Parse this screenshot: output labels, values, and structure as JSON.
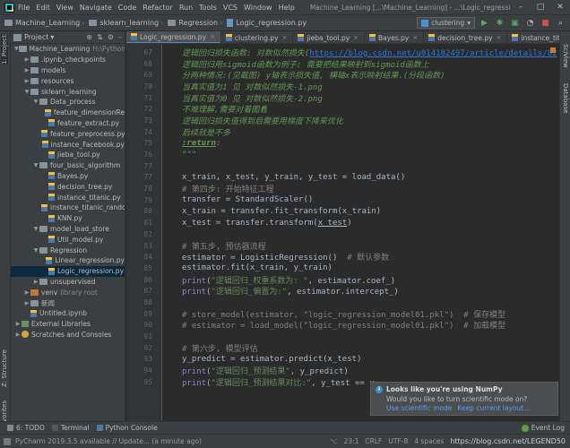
{
  "menubar": {
    "items": [
      "File",
      "Edit",
      "View",
      "Navigate",
      "Code",
      "Refactor",
      "Run",
      "Tools",
      "VCS",
      "Window",
      "Help"
    ],
    "window_title": "Machine_Learning [...\\Machine_Learning] - ...\\Logic_regression.py",
    "controls": [
      "–",
      "□",
      "✕"
    ]
  },
  "navbar": {
    "breadcrumbs": [
      "Machine_Learning",
      "sklearn_learning",
      "Regression",
      "Logic_regression.py"
    ],
    "run_config": "clustering"
  },
  "project": {
    "title": "Project",
    "tree": [
      {
        "indent": 0,
        "type": "folder",
        "label": "Machine_Learning",
        "extra": "H:\\Python_l",
        "open": true
      },
      {
        "indent": 1,
        "type": "folder",
        "label": ".ipynb_checkpoints",
        "open": false
      },
      {
        "indent": 1,
        "type": "folder",
        "label": "models",
        "open": false
      },
      {
        "indent": 1,
        "type": "folder",
        "label": "resources",
        "open": false
      },
      {
        "indent": 1,
        "type": "folder",
        "label": "sklearn_learning",
        "open": true
      },
      {
        "indent": 2,
        "type": "folder",
        "label": "Data_process",
        "open": true
      },
      {
        "indent": 3,
        "type": "py",
        "label": "feature_dimensionRe"
      },
      {
        "indent": 3,
        "type": "py",
        "label": "feature_extract.py"
      },
      {
        "indent": 3,
        "type": "py",
        "label": "feature_preprocess.py"
      },
      {
        "indent": 3,
        "type": "py",
        "label": "instance_Facebook.py"
      },
      {
        "indent": 3,
        "type": "py",
        "label": "jieba_tool.py"
      },
      {
        "indent": 2,
        "type": "folder",
        "label": "four_basic_algorithm",
        "open": true
      },
      {
        "indent": 3,
        "type": "py",
        "label": "Bayes.py"
      },
      {
        "indent": 3,
        "type": "py",
        "label": "decision_tree.py"
      },
      {
        "indent": 3,
        "type": "py",
        "label": "instance_titanic.py"
      },
      {
        "indent": 3,
        "type": "py",
        "label": "instance_titanic_rando"
      },
      {
        "indent": 3,
        "type": "py",
        "label": "KNN.py"
      },
      {
        "indent": 2,
        "type": "folder",
        "label": "model_load_store",
        "open": true
      },
      {
        "indent": 3,
        "type": "py",
        "label": "Util_model.py"
      },
      {
        "indent": 2,
        "type": "folder",
        "label": "Regression",
        "open": true
      },
      {
        "indent": 3,
        "type": "py",
        "label": "Linear_regression.py"
      },
      {
        "indent": 3,
        "type": "py",
        "label": "Logic_regression.py",
        "selected": true
      },
      {
        "indent": 2,
        "type": "folder",
        "label": "unsupervised",
        "open": false
      },
      {
        "indent": 1,
        "type": "excluded",
        "label": "venv",
        "extra": "library root",
        "open": false
      },
      {
        "indent": 1,
        "type": "folder",
        "label": "新闻",
        "open": false
      },
      {
        "indent": 1,
        "type": "py",
        "label": "Untitled.ipynb"
      },
      {
        "indent": 0,
        "type": "lib",
        "label": "External Libraries",
        "open": false
      },
      {
        "indent": 0,
        "type": "scratch",
        "label": "Scratches and Consoles",
        "open": false
      }
    ]
  },
  "tabs": [
    {
      "label": "Logic_regression.py",
      "active": true
    },
    {
      "label": "clustering.py"
    },
    {
      "label": "jieba_tool.py"
    },
    {
      "label": "Bayes.py"
    },
    {
      "label": "decision_tree.py"
    },
    {
      "label": "instance_titanic.py"
    }
  ],
  "code_lines": [
    {
      "n": "67",
      "indent": "",
      "parts": [
        {
          "t": "逻辑回归损失函数: 对数似然损失(",
          "c": "doc"
        },
        {
          "t": "https://blog.csdn.net/u014182497/article/details/82",
          "c": "link"
        }
      ]
    },
    {
      "n": "68",
      "indent": "",
      "parts": [
        {
          "t": "逻辑回归用sigmoid函数为例子: 需要把结果映射到sigmoid函数上",
          "c": "doc"
        }
      ]
    },
    {
      "n": "69",
      "indent": "",
      "parts": [
        {
          "t": "分两种情况:(见截图) y轴表示损失值, 横轴x表示映射结果.(分段函数)",
          "c": "doc"
        }
      ]
    },
    {
      "n": "70",
      "indent": "",
      "parts": [
        {
          "t": "当真实值为1 见 对数似然损失-1.png",
          "c": "doc"
        }
      ]
    },
    {
      "n": "71",
      "indent": "",
      "parts": [
        {
          "t": "当真实值为0 见 对数似然损失-2.png",
          "c": "doc"
        }
      ]
    },
    {
      "n": "72",
      "indent": "",
      "parts": [
        {
          "t": "不难理解,需要对着图看",
          "c": "doc"
        }
      ]
    },
    {
      "n": "73",
      "indent": "",
      "parts": [
        {
          "t": "逻辑回归损失值得到后需要用梯度下降来优化",
          "c": "doc"
        }
      ]
    },
    {
      "n": "74",
      "indent": "",
      "parts": [
        {
          "t": "后续就是不多",
          "c": "doc"
        }
      ]
    },
    {
      "n": "75",
      "indent": "",
      "parts": [
        {
          "t": ":return",
          "c": "tag"
        },
        {
          "t": ":",
          "c": "doc"
        }
      ]
    },
    {
      "n": "76",
      "indent": "",
      "parts": [
        {
          "t": "\"\"\"",
          "c": "doc"
        }
      ]
    },
    {
      "n": "77",
      "indent": "",
      "parts": []
    },
    {
      "n": "77",
      "indent": "",
      "parts": [
        {
          "t": "x_train, x_test, y_train, y_test = load_data()",
          "c": "plain"
        }
      ]
    },
    {
      "n": "78",
      "indent": "",
      "parts": [
        {
          "t": "# 第四步: 开始特征工程",
          "c": "com"
        }
      ]
    },
    {
      "n": "79",
      "indent": "",
      "parts": [
        {
          "t": "transfer = StandardScaler()",
          "c": "plain"
        }
      ]
    },
    {
      "n": "80",
      "indent": "",
      "parts": [
        {
          "t": "x_train = transfer.fit_transform(x_train)",
          "c": "plain"
        }
      ]
    },
    {
      "n": "81",
      "indent": "",
      "parts": [
        {
          "t": "x_test = transfer.transform(",
          "c": "plain"
        },
        {
          "t": "x_test",
          "c": "ul"
        },
        {
          "t": ")",
          "c": "plain"
        }
      ]
    },
    {
      "n": "82",
      "indent": "",
      "parts": []
    },
    {
      "n": "83",
      "indent": "",
      "parts": [
        {
          "t": "# 第五步, 预估器流程",
          "c": "com"
        }
      ]
    },
    {
      "n": "84",
      "indent": "",
      "parts": [
        {
          "t": "estimator = LogisticRegression()  ",
          "c": "plain"
        },
        {
          "t": "# 默认参数",
          "c": "com"
        }
      ]
    },
    {
      "n": "85",
      "indent": "",
      "parts": [
        {
          "t": "estimator.fit(x_train, y_train)",
          "c": "plain"
        }
      ]
    },
    {
      "n": "86",
      "indent": "",
      "parts": [
        {
          "t": "print",
          "c": "kw"
        },
        {
          "t": "(",
          "c": "plain"
        },
        {
          "t": "\"逻辑回归_权重系数为: \"",
          "c": "str"
        },
        {
          "t": ", estimator.coef_)",
          "c": "plain"
        }
      ]
    },
    {
      "n": "87",
      "indent": "",
      "parts": [
        {
          "t": "print",
          "c": "kw"
        },
        {
          "t": "(",
          "c": "plain"
        },
        {
          "t": "\"逻辑回归_偏置为:\"",
          "c": "str"
        },
        {
          "t": ", estimator.intercept_)",
          "c": "plain"
        }
      ]
    },
    {
      "n": "88",
      "indent": "",
      "parts": []
    },
    {
      "n": "89",
      "indent": "",
      "parts": [
        {
          "t": "# store_model(estimator, \"logic_regression_model01.pkl\")  # 保存模型",
          "c": "com"
        }
      ]
    },
    {
      "n": "90",
      "indent": "",
      "parts": [
        {
          "t": "# estimator = load_model(\"logic_regression_model01.pkl\")  # 加载模型",
          "c": "com"
        }
      ]
    },
    {
      "n": "91",
      "indent": "",
      "parts": []
    },
    {
      "n": "92",
      "indent": "",
      "parts": [
        {
          "t": "# 第六步, 模型评估",
          "c": "com"
        }
      ]
    },
    {
      "n": "93",
      "indent": "",
      "parts": [
        {
          "t": "y_predict = estimator.predict(x_test)",
          "c": "plain"
        }
      ]
    },
    {
      "n": "94",
      "indent": "",
      "parts": [
        {
          "t": "print",
          "c": "kw"
        },
        {
          "t": "(",
          "c": "plain"
        },
        {
          "t": "\"逻辑回归_预测结果\"",
          "c": "str"
        },
        {
          "t": ", y_predict)",
          "c": "plain"
        }
      ]
    },
    {
      "n": "95",
      "indent": "",
      "parts": [
        {
          "t": "print",
          "c": "kw"
        },
        {
          "t": "(",
          "c": "plain"
        },
        {
          "t": "\"逻辑回归_预测结果对比:\"",
          "c": "str"
        },
        {
          "t": ", y_test == y",
          "c": "plain"
        }
      ]
    }
  ],
  "notification": {
    "title": "Looks like you're using NumPy",
    "body": "Would you like to turn scientific mode on?",
    "link1": "Use scientific mode",
    "link2": "Keep current layout..."
  },
  "toolwindows": {
    "todo": "6: TODO",
    "terminal": "Terminal",
    "python_console": "Python Console",
    "event_log": "Event Log"
  },
  "left_tabs": {
    "project": "1: Project",
    "structure": "Z: Structure",
    "favorites": "2: Favorites"
  },
  "right_tabs": {
    "scview": "SciView",
    "database": "Database"
  },
  "status": {
    "message": "PyCharm 2019.3.5 available // Update... (a minute ago)",
    "position": "23:1",
    "line_sep": "CRLF",
    "encoding": "UTF-8",
    "indent": "4 spaces",
    "watermark": "https://blog.csdn.net/LEGEND50"
  }
}
